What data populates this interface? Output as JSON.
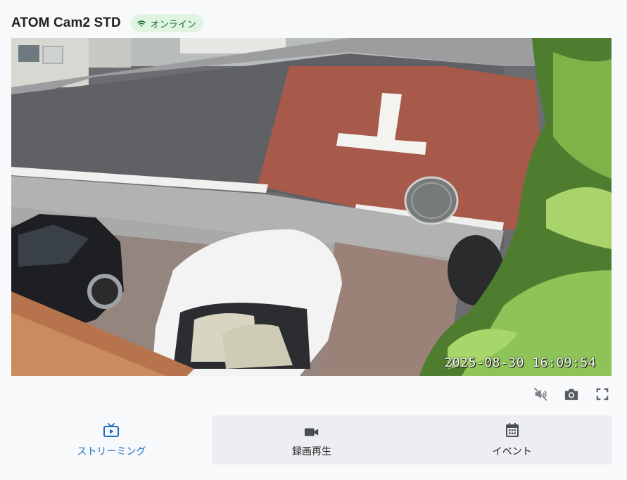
{
  "header": {
    "title": "ATOM Cam2 STD",
    "status_badge": {
      "label": "オンライン",
      "icon": "wifi-icon",
      "color": "#1e6b2a",
      "background": "#dff5e1"
    }
  },
  "video": {
    "timestamp": "2025-08-30 16:09:54"
  },
  "controls": [
    {
      "name": "mute-button",
      "icon": "volume-off-icon"
    },
    {
      "name": "snapshot-button",
      "icon": "camera-icon"
    },
    {
      "name": "fullscreen-button",
      "icon": "fullscreen-icon"
    }
  ],
  "tabs": [
    {
      "label": "ストリーミング",
      "icon": "live-tv-icon",
      "active": true
    },
    {
      "label": "録画再生",
      "icon": "video-camera-icon",
      "active": false
    },
    {
      "label": "イベント",
      "icon": "calendar-icon",
      "active": false
    }
  ],
  "colors": {
    "accent": "#1a6fc4",
    "tab_inactive_bg": "#eceef1"
  }
}
